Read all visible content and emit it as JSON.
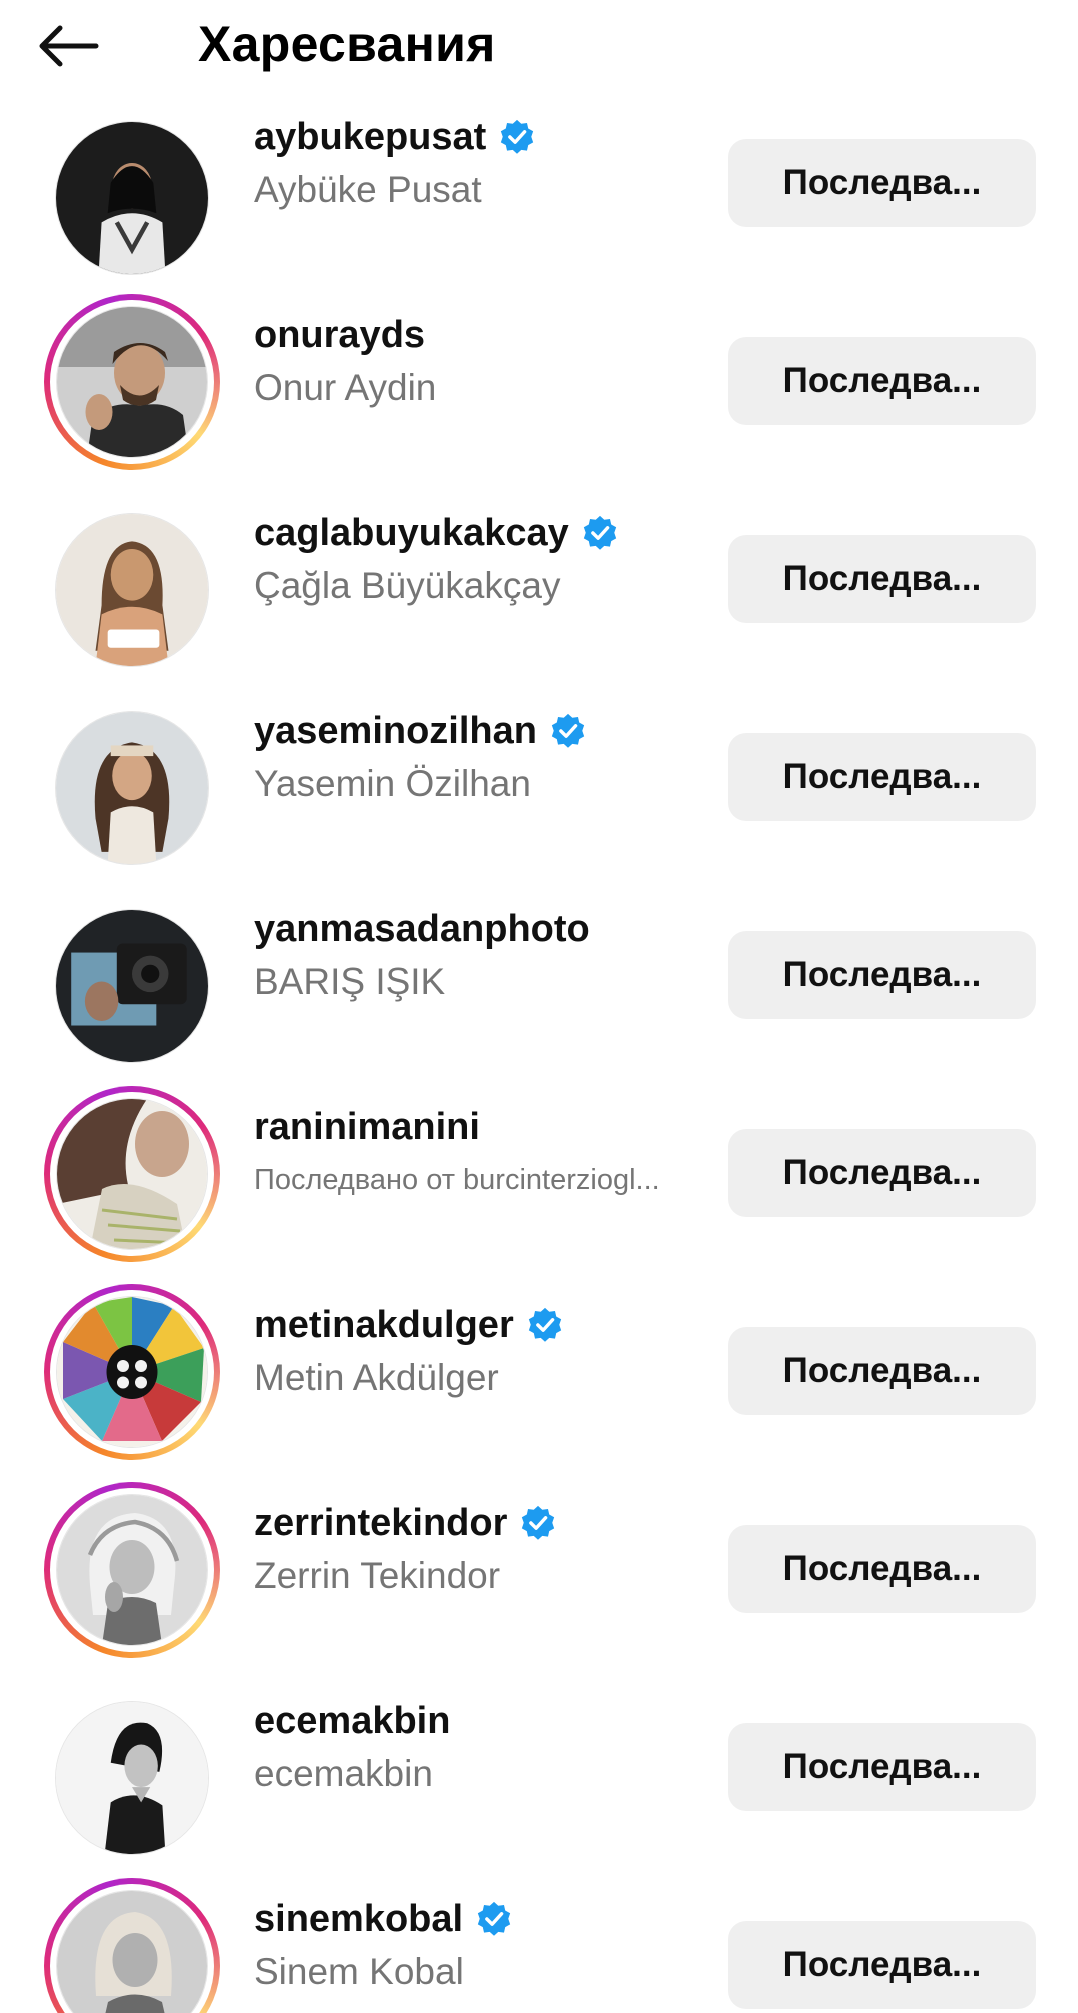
{
  "header": {
    "title": "Харесвания",
    "back_icon": "arrow-left-icon"
  },
  "accent": {
    "verified_color": "#1d9bf0",
    "story_ring": [
      "#feda75",
      "#f58529",
      "#dd2a7b",
      "#b026c9"
    ],
    "button_bg": "#efefef",
    "secondary_text": "#757575"
  },
  "users": [
    {
      "username": "aybukepusat",
      "fullname": "Aybüke Pusat",
      "verified": true,
      "story": false,
      "button": "Последва..."
    },
    {
      "username": "onurayds",
      "fullname": "Onur Aydin",
      "verified": false,
      "story": true,
      "button": "Последва..."
    },
    {
      "username": "caglabuyukakcay",
      "fullname": "Çağla Büyükakçay",
      "verified": true,
      "story": false,
      "button": "Последва..."
    },
    {
      "username": "yaseminozilhan",
      "fullname": "Yasemin Özilhan",
      "verified": true,
      "story": false,
      "button": "Последва..."
    },
    {
      "username": "yanmasadanphoto",
      "fullname": "BARIŞ IŞIK",
      "verified": false,
      "story": false,
      "button": "Последва..."
    },
    {
      "username": "raninimanini",
      "fullname": "Последвано от burcinterziogl...",
      "verified": false,
      "story": true,
      "button": "Последва..."
    },
    {
      "username": "metinakdulger",
      "fullname": "Metin Akdülger",
      "verified": true,
      "story": true,
      "button": "Последва..."
    },
    {
      "username": "zerrintekindor",
      "fullname": "Zerrin Tekindor",
      "verified": true,
      "story": true,
      "button": "Последва..."
    },
    {
      "username": "ecemakbin",
      "fullname": "ecemakbin",
      "verified": false,
      "story": false,
      "button": "Последва..."
    },
    {
      "username": "sinemkobal",
      "fullname": "Sinem Kobal",
      "verified": true,
      "story": true,
      "button": "Последва..."
    }
  ]
}
